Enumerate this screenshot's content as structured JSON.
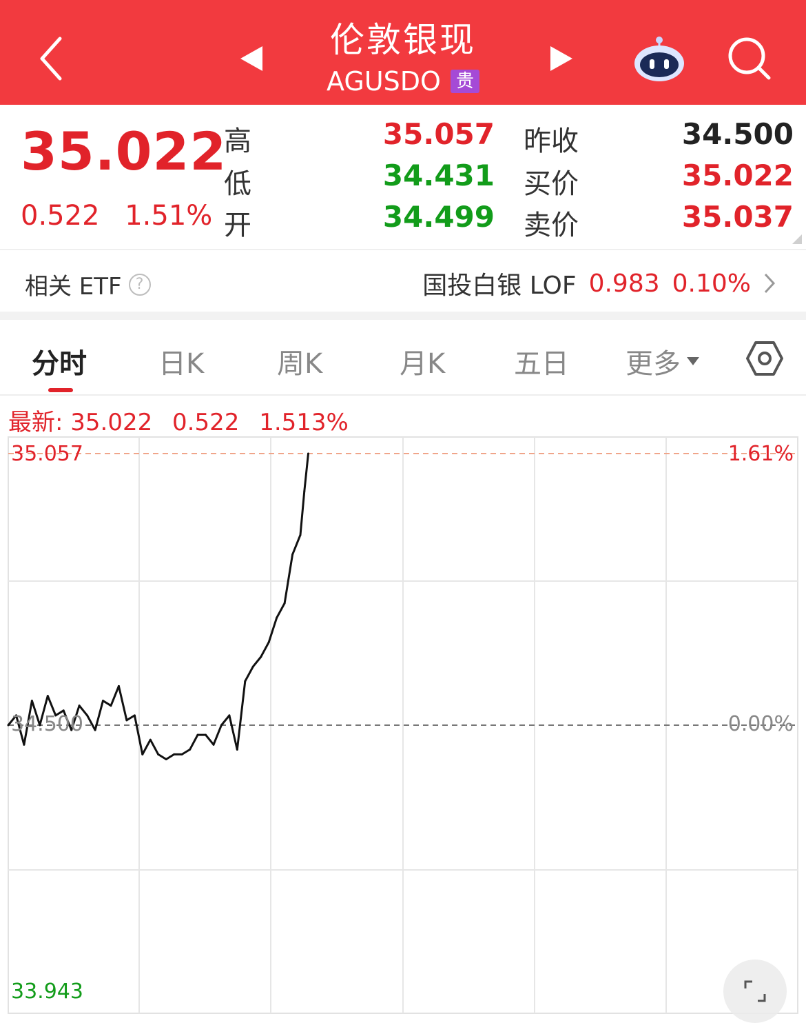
{
  "header": {
    "title": "伦敦银现",
    "symbol": "AGUSDO",
    "badge": "贵",
    "icons": [
      "back-arrow-icon",
      "prev-triangle-icon",
      "next-triangle-icon",
      "robot-assistant-icon",
      "search-icon"
    ]
  },
  "quote": {
    "price": "35.022",
    "change": "0.522",
    "change_pct": "1.51%",
    "labels": {
      "high": "高",
      "low": "低",
      "open": "开",
      "prev_close": "昨收",
      "bid": "买价",
      "ask": "卖价"
    },
    "values": {
      "high": "35.057",
      "low": "34.431",
      "open": "34.499",
      "prev_close": "34.500",
      "bid": "35.022",
      "ask": "35.037"
    }
  },
  "etf": {
    "label": "相关 ETF",
    "help": "?",
    "name": "国投白银 LOF",
    "price": "0.983",
    "pct": "0.10%"
  },
  "tabs": [
    "分时",
    "日K",
    "周K",
    "月K",
    "五日",
    "更多"
  ],
  "latest": {
    "label": "最新: 35.022",
    "change": "0.522",
    "pct": "1.513%"
  },
  "colors": {
    "brand_red": "#f23a3f",
    "up_red": "#e1232a",
    "down_green": "#129c1a",
    "badge_purple": "#a54ad6"
  },
  "chart_data": {
    "type": "line",
    "y_top_label": "35.057",
    "y_mid_label": "34.500",
    "y_bottom_label": "33.943",
    "right_top_label": "1.61%",
    "right_mid_label": "0.00%",
    "ylim": [
      33.943,
      35.057
    ],
    "reference_line": 34.5,
    "x_fraction": [
      0.0,
      0.01,
      0.02,
      0.03,
      0.04,
      0.05,
      0.06,
      0.07,
      0.08,
      0.09,
      0.1,
      0.11,
      0.12,
      0.13,
      0.14,
      0.15,
      0.16,
      0.17,
      0.18,
      0.19,
      0.2,
      0.21,
      0.22,
      0.23,
      0.24,
      0.25,
      0.26,
      0.27,
      0.28,
      0.29,
      0.3,
      0.31,
      0.32,
      0.33,
      0.34,
      0.35,
      0.36,
      0.37,
      0.375,
      0.38
    ],
    "values": [
      34.5,
      34.52,
      34.46,
      34.55,
      34.5,
      34.56,
      34.52,
      34.53,
      34.49,
      34.54,
      34.52,
      34.49,
      34.55,
      34.54,
      34.58,
      34.51,
      34.52,
      34.44,
      34.47,
      34.44,
      34.43,
      34.44,
      34.44,
      34.45,
      34.48,
      34.48,
      34.46,
      34.5,
      34.52,
      34.45,
      34.59,
      34.62,
      34.64,
      34.67,
      34.72,
      34.75,
      34.85,
      34.89,
      34.98,
      35.057
    ]
  }
}
